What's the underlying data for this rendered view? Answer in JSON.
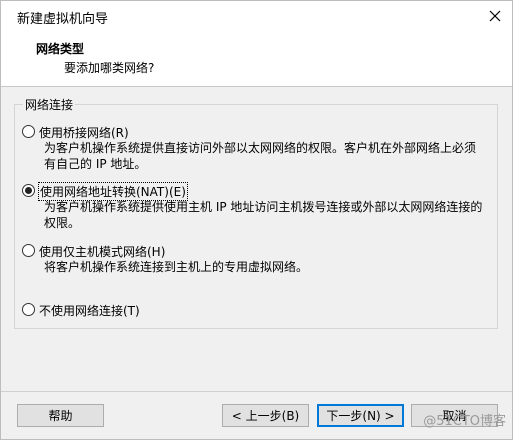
{
  "window": {
    "title": "新建虚拟机向导"
  },
  "header": {
    "title": "网络类型",
    "subtitle": "要添加哪类网络?"
  },
  "group": {
    "legend": "网络连接",
    "options": [
      {
        "label": "使用桥接网络(R)",
        "description": "为客户机操作系统提供直接访问外部以太网网络的权限。客户机在外部网络上必须有自己的 IP 地址。",
        "selected": false
      },
      {
        "label": "使用网络地址转换(NAT)(E)",
        "description": "为客户机操作系统提供使用主机 IP 地址访问主机拨号连接或外部以太网网络连接的权限。",
        "selected": true
      },
      {
        "label": "使用仅主机模式网络(H)",
        "description": "将客户机操作系统连接到主机上的专用虚拟网络。",
        "selected": false
      },
      {
        "label": "不使用网络连接(T)",
        "description": "",
        "selected": false
      }
    ]
  },
  "buttons": {
    "help": "帮助",
    "back": "< 上一步(B)",
    "next": "下一步(N) >",
    "cancel": "取消"
  },
  "watermark": "@51CTO博客",
  "icons": {
    "close": "close-icon"
  }
}
